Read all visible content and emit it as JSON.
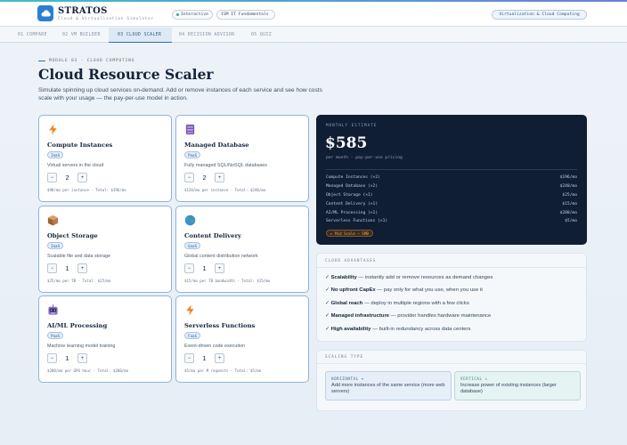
{
  "app": {
    "name": "STRATOS",
    "subtitle": "Cloud & Virtualization Simulator",
    "badges": [
      "Interactive",
      "ISM IT Fundamentals"
    ],
    "topic_badge": "Virtualization & Cloud Computing",
    "colors": {
      "accent": "#2b6fb5",
      "dark_panel": "#0f1e33",
      "warning": "#f0a45a"
    }
  },
  "tabs": [
    {
      "label": "01 COMPARE",
      "active": false
    },
    {
      "label": "02 VM BUILDER",
      "active": false
    },
    {
      "label": "03 CLOUD SCALER",
      "active": true
    },
    {
      "label": "04 DECISION ADVISOR",
      "active": false
    },
    {
      "label": "05 QUIZ",
      "active": false
    }
  ],
  "intro": {
    "module_tag": "MODULE 03 · CLOUD COMPUTING",
    "title": "Cloud Resource Scaler",
    "description": "Simulate spinning up cloud services on-demand. Add or remove instances of each service and see how costs scale with your usage — the pay-per-use model in action."
  },
  "services": [
    {
      "icon": "lightning-icon",
      "name": "Compute Instances",
      "badge": "IaaS",
      "description": "Virtual servers in the cloud",
      "count": "2",
      "price_line": "$98/mo per instance · Total: $196/mo"
    },
    {
      "icon": "database-icon",
      "name": "Managed Database",
      "badge": "PaaS",
      "description": "Fully managed SQL/NoSQL databases",
      "count": "2",
      "price_line": "$120/mo per instance · Total: $240/mo"
    },
    {
      "icon": "storage-box-icon",
      "name": "Object Storage",
      "badge": "IaaS",
      "description": "Scalable file and data storage",
      "count": "1",
      "price_line": "$25/mo per TB · Total: $25/mo"
    },
    {
      "icon": "globe-icon",
      "name": "Content Delivery",
      "badge": "SaaS",
      "description": "Global content distribution network",
      "count": "1",
      "price_line": "$15/mo per TB bandwidth · Total: $15/mo"
    },
    {
      "icon": "robot-icon",
      "name": "AI/ML Processing",
      "badge": "PaaS",
      "description": "Machine learning model training",
      "count": "1",
      "price_line": "$200/mo per GPU hour · Total: $200/mo"
    },
    {
      "icon": "lightning-icon",
      "name": "Serverless Functions",
      "badge": "FaaS",
      "description": "Event-driven code execution",
      "count": "1",
      "price_line": "$5/mo per M requests · Total: $5/mo"
    }
  ],
  "controls": {
    "minus": "−",
    "plus": "+"
  },
  "estimate": {
    "label": "MONTHLY ESTIMATE",
    "total": "$585",
    "subtitle": "per month · pay-per-use pricing",
    "rows": [
      {
        "name": "Compute Instances (×2)",
        "value": "$196/mo"
      },
      {
        "name": "Managed Database (×2)",
        "value": "$240/mo"
      },
      {
        "name": "Object Storage (×1)",
        "value": "$25/mo"
      },
      {
        "name": "Content Delivery (×1)",
        "value": "$15/mo"
      },
      {
        "name": "AI/ML Processing (×1)",
        "value": "$200/mo"
      },
      {
        "name": "Serverless Functions (×1)",
        "value": "$5/mo"
      }
    ],
    "scale_badge": "▸ Mid Scale — SMB"
  },
  "advantages": {
    "label": "CLOUD ADVANTAGES",
    "items": [
      {
        "title": "Scalability",
        "text": " — instantly add or remove resources as demand changes"
      },
      {
        "title": "No upfront CapEx",
        "text": " — pay only for what you use, when you use it"
      },
      {
        "title": "Global reach",
        "text": " — deploy in multiple regions with a few clicks"
      },
      {
        "title": "Managed infrastructure",
        "text": " — provider handles hardware maintenance"
      },
      {
        "title": "High availability",
        "text": " — built-in redundancy across data centers"
      }
    ],
    "check": "✓"
  },
  "scaling": {
    "label": "SCALING TYPE",
    "horizontal": {
      "title": "HORIZONTAL ↔",
      "text": "Add more instances of the same service (more web servers)"
    },
    "vertical": {
      "title": "VERTICAL ↕",
      "text": "Increase power of existing instances (larger database)"
    }
  }
}
